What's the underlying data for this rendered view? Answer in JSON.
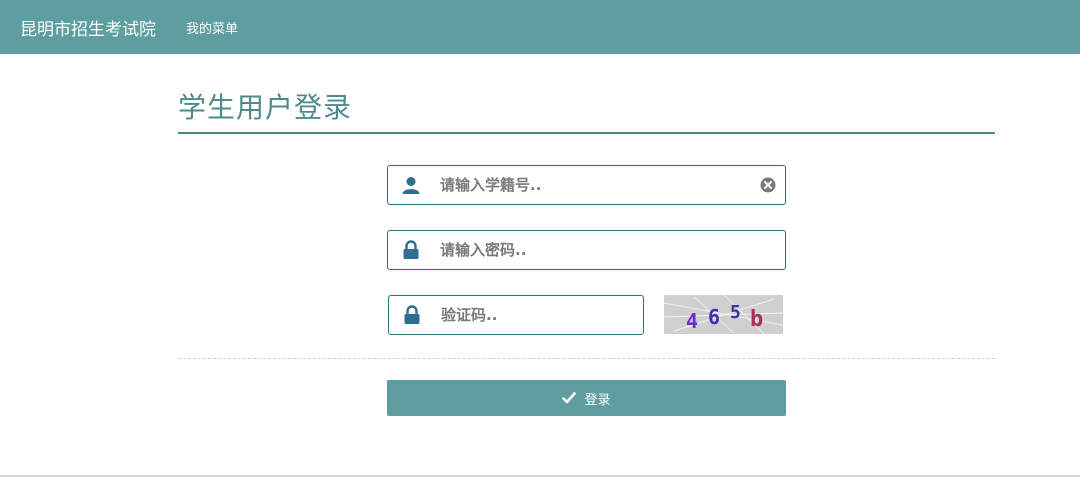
{
  "navbar": {
    "brand": "昆明市招生考试院",
    "menu_label": "我的菜单"
  },
  "form": {
    "title": "学生用户登录",
    "student_id": {
      "placeholder": "请输入学籍号..",
      "value": ""
    },
    "password": {
      "placeholder": "请输入密码..",
      "value": ""
    },
    "captcha": {
      "placeholder": "验证码..",
      "value": "",
      "image_text": [
        "4",
        "6",
        "5",
        "b"
      ]
    },
    "login_label": "登录"
  },
  "colors": {
    "accent": "#5f9ea0",
    "heading": "#4e8a8c",
    "field_border": "#2f6f83",
    "icon": "#2e6f8e"
  },
  "icons": {
    "user": "user-icon",
    "lock": "lock-icon",
    "clear": "clear-icon",
    "check": "check-icon"
  }
}
